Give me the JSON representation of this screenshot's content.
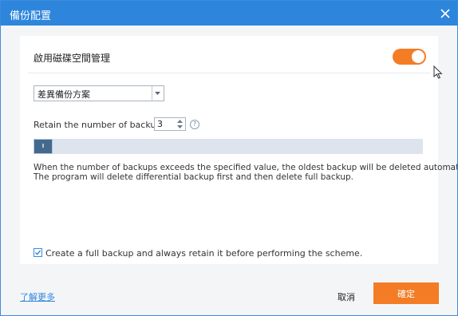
{
  "window": {
    "title": "備份配置",
    "colors": {
      "titlebar": "#2d86dc",
      "accent": "#f37c25",
      "link": "#2d86dc"
    }
  },
  "panel": {
    "section_title": "啟用磁碟空間管理",
    "toggle_on": true,
    "scheme_select": {
      "value": "差異備份方案"
    },
    "retain": {
      "label": "Retain the number of backups:",
      "value": "3",
      "help_glyph": "?"
    },
    "slider": {
      "level_fraction": 0.05
    },
    "description": {
      "line1": "When the number of backups exceeds the specified value, the oldest backup will be deleted automatically.",
      "line2": "The program will delete differential backup first and then delete full backup."
    },
    "full_backup_checkbox": {
      "checked": true,
      "label": "Create a full backup and always retain it before performing the scheme."
    }
  },
  "footer": {
    "learn_more": "了解更多",
    "cancel": "取消",
    "ok": "確定"
  },
  "icons": {
    "close": "close-icon",
    "dropdown": "chevron-down-icon",
    "spin_up": "triangle-up-icon",
    "spin_down": "triangle-down-icon",
    "help": "question-circle-icon",
    "check": "checkmark-icon",
    "cursor": "mouse-pointer-icon"
  }
}
